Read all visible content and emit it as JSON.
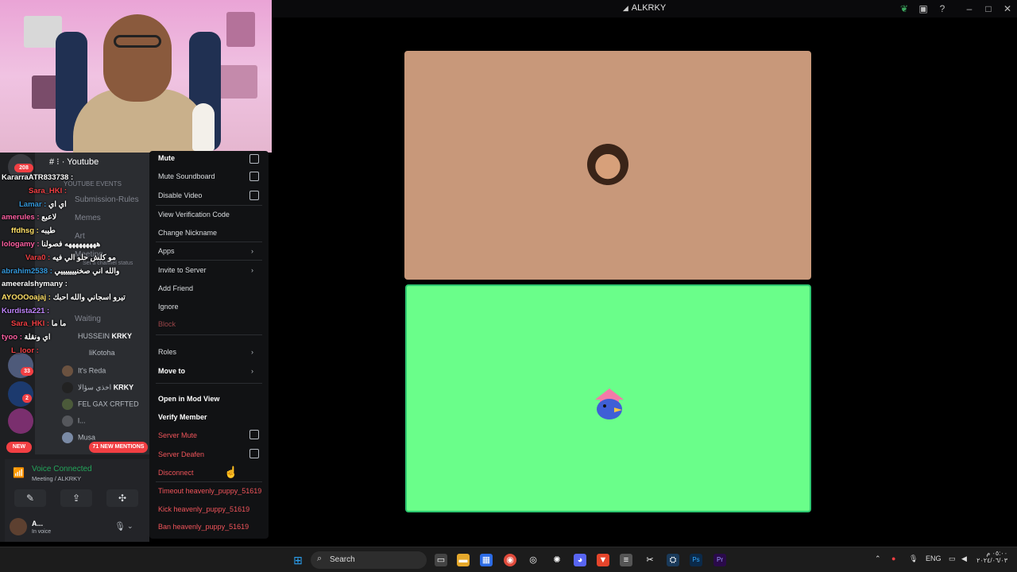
{
  "window": {
    "title": "ALKRKY"
  },
  "sidebar": {
    "server_name": "Youtube",
    "category": "YOUTUBE EVENTS",
    "channels": [
      "Submission-Rules",
      "Memes",
      "Art",
      "Meeting",
      "Waiting"
    ],
    "channel_status": "Set a channel status",
    "badges": {
      "top": "208",
      "mid": "33",
      "low": "2"
    },
    "new_pill": "NEW",
    "mentions_pill": "71 NEW MENTIONS"
  },
  "chat_overlay": [
    {
      "user": "KararraATR833738 :",
      "msg": "",
      "color": "#ffffff"
    },
    {
      "user": "Sara_HKI :",
      "msg": "",
      "color": "#f23f43"
    },
    {
      "user": "Lamar :",
      "msg": "اي اي",
      "color": "#3498db"
    },
    {
      "user": "amerules :",
      "msg": "لاعبع",
      "color": "#ff5fa2"
    },
    {
      "user": "ffdhsg :",
      "msg": "طيبه",
      "color": "#ffe066"
    },
    {
      "user": "lologamy :",
      "msg": "هههههههههه فصولنا",
      "color": "#ff5fa2"
    },
    {
      "user": "Vara0 :",
      "msg": "مو كلش حلو الي فيه",
      "color": "#f23f43"
    },
    {
      "user": "abrahim2538 :",
      "msg": "والله اني صخنيييييييي",
      "color": "#3498db"
    },
    {
      "user": "ameeralshymany :",
      "msg": "",
      "color": "#ffffff"
    },
    {
      "user": "AYOOOoajaj :",
      "msg": "تيرو اسجاني والله احبك",
      "color": "#ffe066"
    },
    {
      "user": "Kurdista221 :",
      "msg": "",
      "color": "#c084fc"
    },
    {
      "user": "Sara_HKI :",
      "msg": "ما ما",
      "color": "#f23f43"
    },
    {
      "user": "tyoo :",
      "msg": "اي ونقلة",
      "color": "#ff5fa2"
    },
    {
      "user": "L_loor :",
      "msg": "",
      "color": "#f23f43"
    }
  ],
  "voice_members": [
    {
      "name": "HUSSEIN",
      "tag": "KRKY"
    },
    {
      "name": "liKotoha",
      "tag": ""
    },
    {
      "name": "It's Reda",
      "tag": ""
    },
    {
      "name": "اخذي سؤالا",
      "tag": "KRKY"
    },
    {
      "name": "FEL GAX CRFTED",
      "tag": ""
    },
    {
      "name": "l...",
      "tag": ""
    },
    {
      "name": "Musa",
      "tag": ""
    },
    {
      "name": "A...",
      "tag": "KRKY"
    }
  ],
  "voice_panel": {
    "status": "Voice Connected",
    "location": "Meeting / ALKRKY",
    "user_name": "A...",
    "user_status": "In voice"
  },
  "context_menu": {
    "mute": "Mute",
    "mute_soundboard": "Mute Soundboard",
    "disable_video": "Disable Video",
    "view_verification_code": "View Verification Code",
    "change_nickname": "Change Nickname",
    "apps": "Apps",
    "invite_to_server": "Invite to Server",
    "add_friend": "Add Friend",
    "ignore": "Ignore",
    "block": "Block",
    "roles": "Roles",
    "move_to": "Move to",
    "open_in_mod_view": "Open in Mod View",
    "verify_member": "Verify Member",
    "server_mute": "Server Mute",
    "server_deafen": "Server Deafen",
    "disconnect": "Disconnect",
    "timeout": "Timeout heavenly_puppy_51619",
    "kick": "Kick heavenly_puppy_51619",
    "ban": "Ban heavenly_puppy_51619"
  },
  "taskbar": {
    "search_label": "Search",
    "language": "ENG",
    "clock_time": "٠٥:٠٠ م",
    "clock_date": "٢٠٢٤/٠٦/٠٣"
  },
  "colors": {
    "tile_top": "#c8987a",
    "tile_bottom": "#6afe8a",
    "speaking_border": "#2dc770",
    "danger": "#f0545a",
    "voice_green": "#23a55a"
  }
}
